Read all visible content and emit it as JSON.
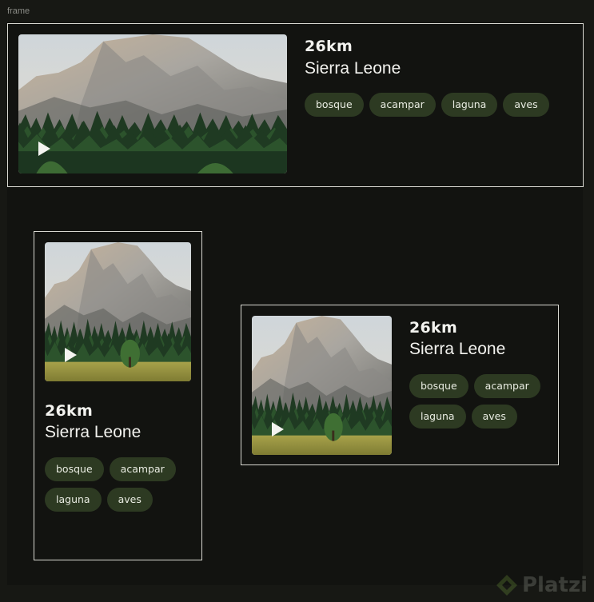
{
  "canvas": {
    "frame_label": "frame"
  },
  "cards": [
    {
      "distance": "26km",
      "location": "Sierra Leone",
      "tags": [
        "bosque",
        "acampar",
        "laguna",
        "aves"
      ]
    },
    {
      "distance": "26km",
      "location": "Sierra Leone",
      "tags": [
        "bosque",
        "acampar",
        "laguna",
        "aves"
      ]
    },
    {
      "distance": "26km",
      "location": "Sierra Leone",
      "tags": [
        "bosque",
        "acampar",
        "laguna",
        "aves"
      ]
    }
  ],
  "watermark": {
    "brand": "Platzi"
  },
  "icons": {
    "play": "play-icon",
    "logo": "platzi-logo-icon"
  },
  "colors": {
    "background": "#171814",
    "frame": "#121310",
    "tag_bg": "#2d3a22",
    "border": "#d9d9d2",
    "text": "#f2f2ee"
  }
}
